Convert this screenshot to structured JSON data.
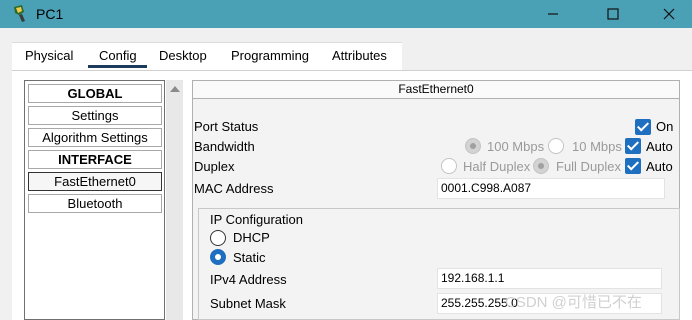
{
  "window": {
    "title": "PC1"
  },
  "tabs": [
    {
      "label": "Physical"
    },
    {
      "label": "Config"
    },
    {
      "label": "Desktop"
    },
    {
      "label": "Programming"
    },
    {
      "label": "Attributes"
    }
  ],
  "active_tab": "Config",
  "sidebar": {
    "items": [
      {
        "label": "GLOBAL",
        "type": "header"
      },
      {
        "label": "Settings",
        "type": "item"
      },
      {
        "label": "Algorithm Settings",
        "type": "item"
      },
      {
        "label": "INTERFACE",
        "type": "header"
      },
      {
        "label": "FastEthernet0",
        "type": "item",
        "selected": true
      },
      {
        "label": "Bluetooth",
        "type": "item"
      }
    ]
  },
  "panel": {
    "title": "FastEthernet0",
    "port_status": {
      "label": "Port Status",
      "on_label": "On",
      "on_checked": true
    },
    "bandwidth": {
      "label": "Bandwidth",
      "options": [
        "100 Mbps",
        "10 Mbps"
      ],
      "auto_label": "Auto",
      "auto_checked": true
    },
    "duplex": {
      "label": "Duplex",
      "options": [
        "Half Duplex",
        "Full Duplex"
      ],
      "auto_label": "Auto",
      "auto_checked": true
    },
    "mac": {
      "label": "MAC Address",
      "value": "0001.C998.A087"
    },
    "ip_config": {
      "label": "IP Configuration",
      "dhcp_label": "DHCP",
      "static_label": "Static",
      "selected": "Static",
      "ipv4_label": "IPv4 Address",
      "ipv4_value": "192.168.1.1",
      "mask_label": "Subnet Mask",
      "mask_value": "255.255.255.0"
    }
  },
  "watermark": "CSDN @可惜已不在",
  "colors": {
    "titlebar": "#4aa0b4",
    "accent": "#1f6fc0",
    "tab_underline": "#1b3a5c"
  }
}
